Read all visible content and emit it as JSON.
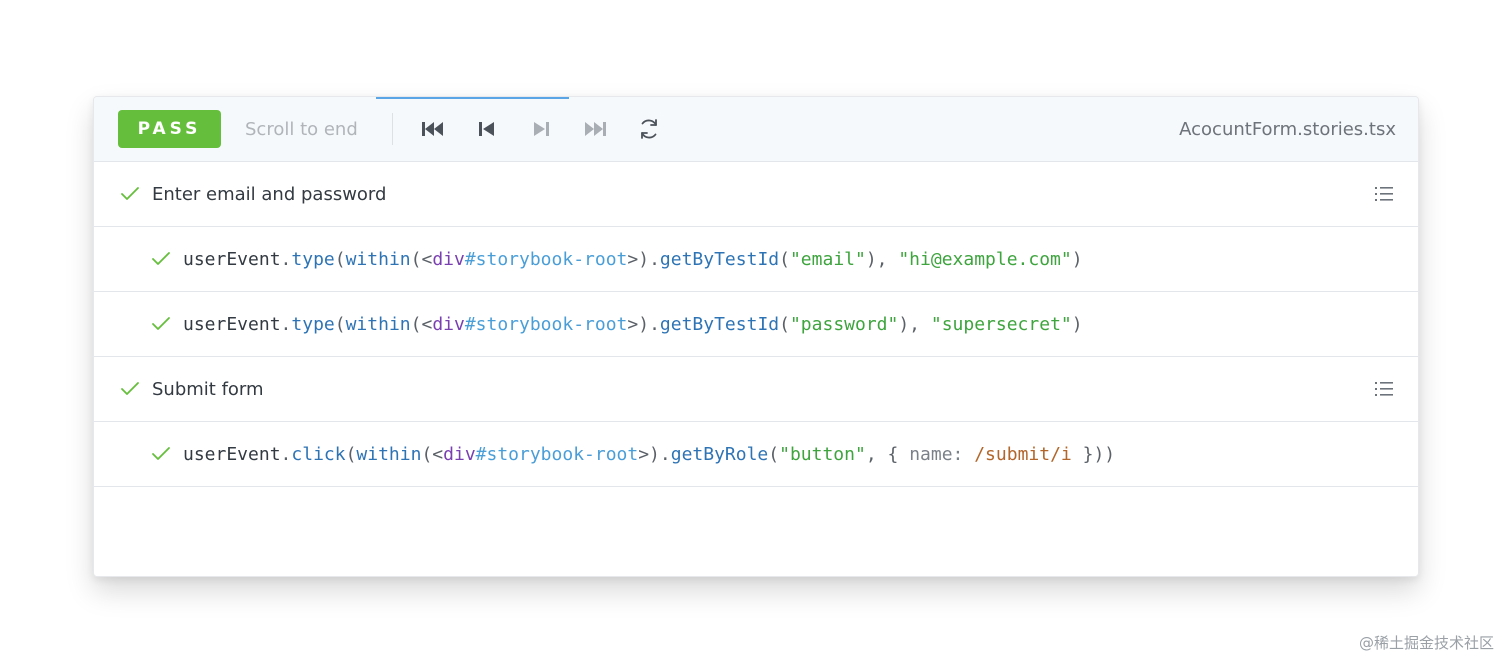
{
  "toolbar": {
    "status_badge": "PASS",
    "scroll_to_end": "Scroll to end",
    "filename": "AcocuntForm.stories.tsx",
    "controls": [
      "go-to-start-icon",
      "step-back-icon",
      "step-forward-icon",
      "go-to-end-icon",
      "rerun-icon"
    ]
  },
  "steps": [
    {
      "label": "Enter email and password",
      "calls": [
        {
          "obj": "userEvent",
          "method": "type",
          "within": "within",
          "tag": "div",
          "id": "#storybook-root",
          "query": "getByTestId",
          "arg": "\"email\"",
          "value": "\"hi@example.com\""
        },
        {
          "obj": "userEvent",
          "method": "type",
          "within": "within",
          "tag": "div",
          "id": "#storybook-root",
          "query": "getByTestId",
          "arg": "\"password\"",
          "value": "\"supersecret\""
        }
      ]
    },
    {
      "label": "Submit form",
      "calls": [
        {
          "obj": "userEvent",
          "method": "click",
          "within": "within",
          "tag": "div",
          "id": "#storybook-root",
          "query": "getByRole",
          "arg": "\"button\"",
          "opt_key": "name:",
          "opt_value": "/submit/i"
        }
      ]
    }
  ],
  "colors": {
    "pass": "#66bf3c",
    "accent": "#5aa5e6",
    "check": "#66bf3c"
  },
  "watermark": "@稀土掘金技术社区"
}
